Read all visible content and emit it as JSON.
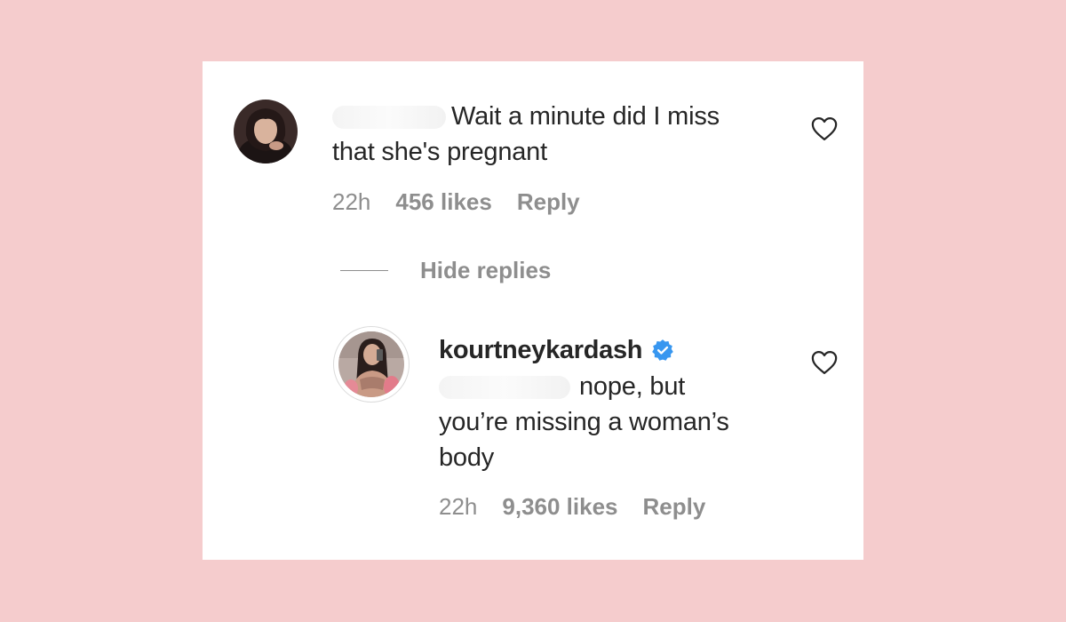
{
  "comment": {
    "text_line1": "Wait a minute did I miss",
    "text_line2": "that she's pregnant",
    "time": "22h",
    "likes": "456 likes",
    "reply_label": "Reply"
  },
  "hide_replies_label": "Hide replies",
  "reply": {
    "username": "kourtneykardash",
    "text_line1": "nope, but",
    "text_line2": "you’re missing a woman’s",
    "text_line3": "body",
    "time": "22h",
    "likes": "9,360 likes",
    "reply_label": "Reply"
  },
  "colors": {
    "background": "#f5cccd",
    "card": "#ffffff",
    "text": "#262626",
    "secondary": "#8e8e8e",
    "verified": "#3897f0"
  }
}
